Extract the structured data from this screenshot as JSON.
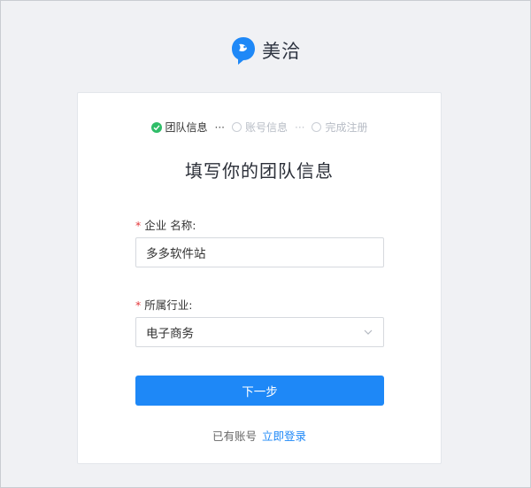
{
  "brand": {
    "name": "美洽",
    "logo_icon": "chat-bird-logo",
    "color": "#1e88f7"
  },
  "steps": [
    {
      "label": "团队信息",
      "state": "done"
    },
    {
      "label": "账号信息",
      "state": "todo"
    },
    {
      "label": "完成注册",
      "state": "todo"
    }
  ],
  "step_separator": "···",
  "form": {
    "title": "填写你的团队信息",
    "required_mark": "*",
    "company": {
      "label": "企业 名称:",
      "value": "多多软件站"
    },
    "industry": {
      "label": "所属行业:",
      "value": "电子商务"
    },
    "next_button": "下一步"
  },
  "login": {
    "prompt": "已有账号",
    "link": "立即登录"
  },
  "colors": {
    "accent": "#1e88f7",
    "success": "#2fbd68",
    "required": "#e4393c"
  }
}
